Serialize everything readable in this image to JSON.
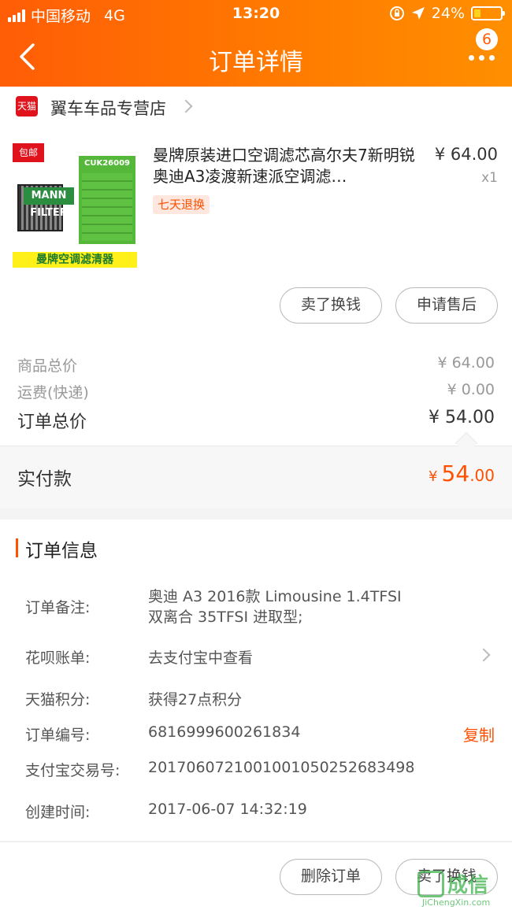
{
  "status_bar": {
    "carrier": "中国移动",
    "network": "4G",
    "time": "13:20",
    "battery": "24%",
    "battery_level": 0.24
  },
  "nav": {
    "title": "订单详情",
    "badge": "6",
    "back_icon": "chevron-left-icon",
    "more_icon": "more-dots-icon"
  },
  "store": {
    "name": "翼车车品专营店",
    "logo_text": "天猫"
  },
  "product": {
    "title": "曼牌原装进口空调滤芯高尔夫7新明锐奥迪A3凌渡新速派空调滤…",
    "price": "¥ 64.00",
    "qty": "x1",
    "tag": "七天退换",
    "image": {
      "free_shipping": "包邮",
      "code": "CUK26009",
      "brand": "MANN FILTER",
      "banner": "曼牌空调滤清器"
    }
  },
  "product_actions": {
    "sell": "卖了换钱",
    "after_sale": "申请售后"
  },
  "totals": {
    "goods_label": "商品总价",
    "goods_value": "¥ 64.00",
    "shipping_label": "运费(快递)",
    "shipping_value": "¥ 0.00",
    "order_total_label": "订单总价",
    "order_total_value": "¥ 54.00"
  },
  "paid": {
    "label": "实付款",
    "currency": "¥",
    "integer": "54",
    "decimal": ".00",
    "accent_color": "#ff5000"
  },
  "order_info": {
    "title": "订单信息",
    "remark_label": "订单备注:",
    "remark_line1": "奥迪 A3 2016款 Limousine 1.4TFSI",
    "remark_line2": "双离合 35TFSI 进取型;",
    "huabei_label": "花呗账单:",
    "huabei_value": "去支付宝中查看",
    "points_label": "天猫积分:",
    "points_value": "获得27点积分",
    "order_no_label": "订单编号:",
    "order_no_value": "6816999600261834",
    "copy_label": "复制",
    "alipay_label": "支付宝交易号:",
    "alipay_value": "2017060721001001050252683498",
    "created_label": "创建时间:",
    "created_value": "2017-06-07 14:32:19"
  },
  "footer": {
    "delete_order": "删除订单",
    "sell": "卖了换钱"
  },
  "watermark": {
    "text": "成信",
    "url": "JiChengXin.com"
  }
}
